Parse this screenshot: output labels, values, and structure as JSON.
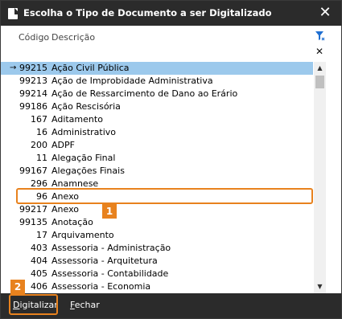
{
  "window": {
    "title": "Escolha o Tipo de Documento a ser Digitalizado",
    "close_glyph": "✕"
  },
  "columns": {
    "code": "Código",
    "description": "Descrição"
  },
  "icons": {
    "filter": "filter-icon",
    "clear": "close-icon",
    "row_pointer": "→"
  },
  "list": {
    "selected_index": 0,
    "highlighted_index": 10,
    "rows": [
      {
        "code": "99215",
        "desc": "Ação Civil Pública"
      },
      {
        "code": "99213",
        "desc": "Ação de Improbidade Administrativa"
      },
      {
        "code": "99214",
        "desc": "Ação de Ressarcimento de Dano ao Erário"
      },
      {
        "code": "99186",
        "desc": "Ação Rescisória"
      },
      {
        "code": "167",
        "desc": "Aditamento"
      },
      {
        "code": "16",
        "desc": "Administrativo"
      },
      {
        "code": "200",
        "desc": "ADPF"
      },
      {
        "code": "11",
        "desc": "Alegação Final"
      },
      {
        "code": "99167",
        "desc": "Alegações Finais"
      },
      {
        "code": "296",
        "desc": "Anamnese"
      },
      {
        "code": "96",
        "desc": "Anexo"
      },
      {
        "code": "99217",
        "desc": "Anexo"
      },
      {
        "code": "99135",
        "desc": "Anotação"
      },
      {
        "code": "17",
        "desc": "Arquivamento"
      },
      {
        "code": "403",
        "desc": "Assessoria - Administração"
      },
      {
        "code": "404",
        "desc": "Assessoria - Arquitetura"
      },
      {
        "code": "405",
        "desc": "Assessoria - Contabilidade"
      },
      {
        "code": "406",
        "desc": "Assessoria - Economia"
      }
    ]
  },
  "annotations": {
    "badge_1": "1",
    "badge_2": "2",
    "accent_color": "#e8821e"
  },
  "footer": {
    "digitalizar_mnemonic": "D",
    "digitalizar_rest": "igitalizar",
    "fechar_mnemonic": "F",
    "fechar_rest": "echar"
  },
  "colors": {
    "titlebar": "#2b2b2b",
    "selected_row": "#9cc9ec",
    "filter_icon": "#1f6fd1"
  }
}
